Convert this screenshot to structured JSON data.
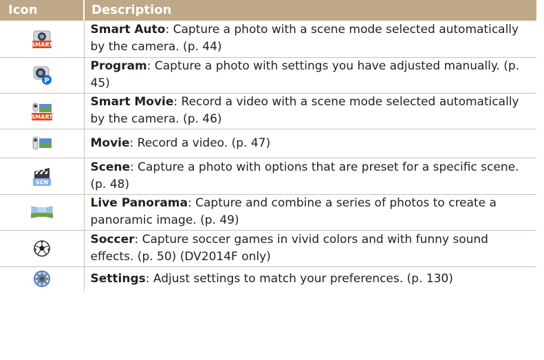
{
  "header": {
    "icon": "Icon",
    "description": "Description"
  },
  "rows": [
    {
      "icon": "smart-auto-icon",
      "icon_label": "SMART",
      "name": "Smart Auto",
      "text": ": Capture a photo with a scene mode selected automatically by the camera. (p. 44)"
    },
    {
      "icon": "program-icon",
      "icon_label": "P",
      "name": "Program",
      "text": ": Capture a photo with settings you have adjusted manually. (p. 45)"
    },
    {
      "icon": "smart-movie-icon",
      "icon_label": "SMART",
      "name": "Smart Movie",
      "text": ": Record a video with a scene mode selected automatically by the camera. (p. 46)"
    },
    {
      "icon": "movie-icon",
      "name": "Movie",
      "text": ": Record a video. (p. 47)"
    },
    {
      "icon": "scene-icon",
      "icon_label": "SCN",
      "name": "Scene",
      "text": ": Capture a photo with options that are preset for a specific scene. (p. 48)"
    },
    {
      "icon": "live-panorama-icon",
      "name": "Live Panorama",
      "text": ": Capture and combine a series of photos to create a panoramic image. (p. 49)"
    },
    {
      "icon": "soccer-icon",
      "name": "Soccer",
      "text": ": Capture soccer games in vivid colors and with funny sound effects. (p. 50) (DV2014F only)"
    },
    {
      "icon": "settings-icon",
      "name": "Settings",
      "text": ": Adjust settings to match your preferences. (p. 130)"
    }
  ],
  "colors": {
    "header_bg": "#bfa888",
    "border": "#c9c0b3",
    "smart_badge": "#e0461f",
    "program_badge": "#1a6fd0"
  }
}
